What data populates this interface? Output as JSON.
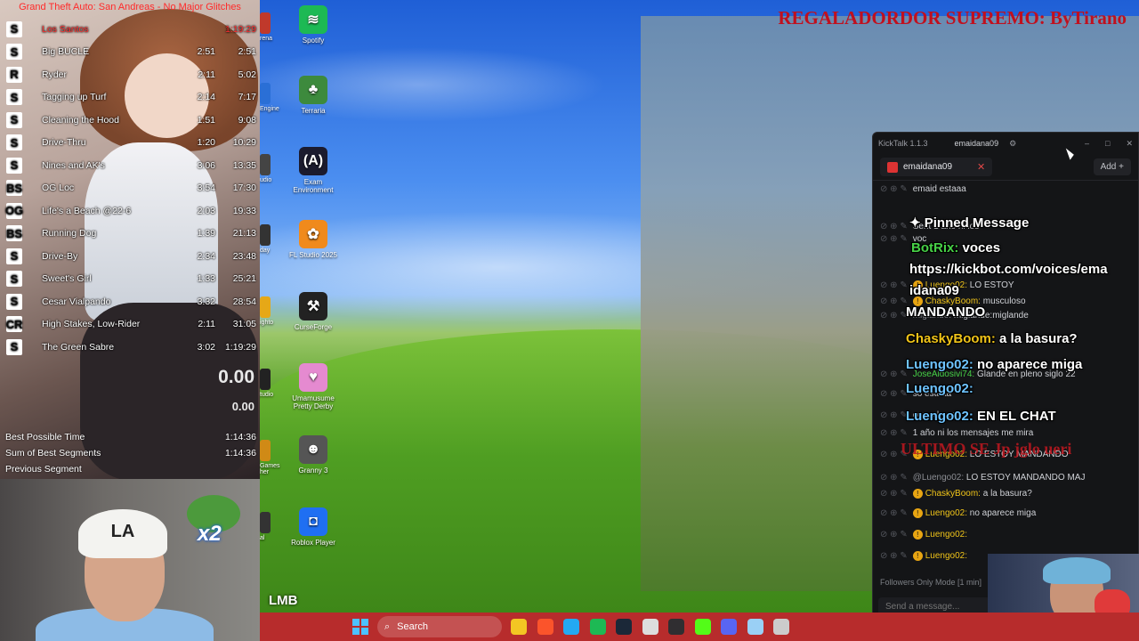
{
  "livesplit": {
    "title": "Grand Theft Auto: San Andreas - No Major Glitches",
    "splits": [
      {
        "icon": "S",
        "name": "Los Santos",
        "segment": "",
        "total": "1:19:29",
        "red": true
      },
      {
        "icon": "S",
        "name": "Big BUCLE",
        "segment": "2:51",
        "total": "2:51"
      },
      {
        "icon": "R",
        "name": "Ryder",
        "segment": "2:11",
        "total": "5:02"
      },
      {
        "icon": "S",
        "name": "Tagging up Turf",
        "segment": "2:14",
        "total": "7:17"
      },
      {
        "icon": "S",
        "name": "Cleaning the Hood",
        "segment": "1:51",
        "total": "9:08"
      },
      {
        "icon": "S",
        "name": "Drive-Thru",
        "segment": "1:20",
        "total": "10:29"
      },
      {
        "icon": "S",
        "name": "Nines and AK's",
        "segment": "3:06",
        "total": "13:35"
      },
      {
        "icon": "BS",
        "name": "OG Loc",
        "segment": "3:54",
        "total": "17:30"
      },
      {
        "icon": "OG",
        "name": "Life's a Beach @22-6",
        "segment": "2:03",
        "total": "19:33"
      },
      {
        "icon": "BS",
        "name": "Running Dog",
        "segment": "1:39",
        "total": "21:13"
      },
      {
        "icon": "S",
        "name": "Drive-By",
        "segment": "2:34",
        "total": "23:48"
      },
      {
        "icon": "S",
        "name": "Sweet's Girl",
        "segment": "1:33",
        "total": "25:21"
      },
      {
        "icon": "S",
        "name": "Cesar Vialpando",
        "segment": "3:32",
        "total": "28:54"
      },
      {
        "icon": "CR",
        "name": "High Stakes, Low-Rider",
        "segment": "2:11",
        "total": "31:05"
      },
      {
        "icon": "S",
        "name": "The Green Sabre",
        "segment": "3:02",
        "total": "1:19:29"
      }
    ],
    "timer_main": "0.00",
    "timer_segment": "0.00",
    "stats": [
      {
        "label": "Best Possible Time",
        "value": "1:14:36"
      },
      {
        "label": "Sum of Best Segments",
        "value": "1:14:36"
      },
      {
        "label": "Previous Segment",
        "value": ""
      }
    ]
  },
  "webcam": {
    "cap_logo": "LA",
    "emote_text": "x2"
  },
  "desktop_icons": [
    {
      "label": "Spotify",
      "icon": "spotify-icon",
      "color": "#1db954",
      "glyph": "≋"
    },
    {
      "label": "Terraria",
      "icon": "terraria-icon",
      "color": "#3d8a3d",
      "glyph": "♣"
    },
    {
      "label": "Exam Environment",
      "icon": "exam-environment-icon",
      "color": "#1b1b2e",
      "glyph": "(A)"
    },
    {
      "label": "FL Studio 2025",
      "icon": "fl-studio-icon",
      "color": "#f08a1c",
      "glyph": "✿"
    },
    {
      "label": "CurseForge",
      "icon": "curseforge-icon",
      "color": "#222",
      "glyph": "⚒"
    },
    {
      "label": "Umamusume Pretty Derby",
      "icon": "umamusume-icon",
      "color": "#e58ad0",
      "glyph": "♥"
    },
    {
      "label": "Granny 3",
      "icon": "granny-icon",
      "color": "#555",
      "glyph": "☻"
    },
    {
      "label": "Roblox Player",
      "icon": "roblox-icon",
      "color": "#1f6ff2",
      "glyph": "◘"
    }
  ],
  "edge_icons": [
    {
      "label": "rena",
      "color": "#c0392b"
    },
    {
      "label": "Engine",
      "color": "#2a6fd6"
    },
    {
      "label": "udio",
      "color": "#444"
    },
    {
      "label": "day",
      "color": "#333"
    },
    {
      "label": "ighto",
      "color": "#e6a817"
    },
    {
      "label": "tudio",
      "color": "#222"
    },
    {
      "label": "Games her",
      "color": "#d08a16"
    },
    {
      "label": "al",
      "color": "#333"
    }
  ],
  "stream_overlay": {
    "title": "REGALADORDOR SUPREMO: ByTirano",
    "lmb": "LMB"
  },
  "kicktalk": {
    "app_name": "KickTalk 1.1.3",
    "username": "emaidana09",
    "tab_label": "emaidana09",
    "add_label": "Add",
    "followers_mode": "Followers Only Mode [1 min]",
    "input_placeholder": "Send a message..."
  },
  "chat_lines": [
    {
      "prefix": "emaid",
      "user": "",
      "text": "estaaa",
      "color": "grey"
    },
    {
      "prefix": "Sent",
      "user": "",
      "text": "1 año ni los",
      "color": "grey"
    },
    {
      "prefix": "voc",
      "user": "",
      "text": "",
      "color": "grey"
    },
    {
      "prefix": "",
      "user": "Luengo02:",
      "text": "LO ESTOY",
      "color": "yellow"
    },
    {
      "prefix": "",
      "user": "ChaskyBoom:",
      "text": "musculoso",
      "color": "yellow"
    },
    {
      "prefix": "",
      "user": "miglande:",
      "text": "miglande:miglande",
      "color": "grey"
    },
    {
      "prefix": "",
      "user": "JoseAldosivi74:",
      "text": "Glande en pleno siglo 22",
      "color": "green"
    },
    {
      "prefix": "",
      "user": "",
      "text": "so estaaa",
      "color": "grey"
    },
    {
      "prefix": "",
      "user": "",
      "text": "como hace",
      "color": "grey"
    },
    {
      "prefix": "",
      "user": "",
      "text": "1 año ni los mensajes me mira",
      "color": "grey"
    },
    {
      "prefix": "",
      "user": "Luengo02:",
      "text": "LO ESTOY MANDANDO",
      "color": "yellow"
    },
    {
      "prefix": "",
      "user": "@Luengo02:",
      "text": "LO ESTOY MANDANDO MAJ",
      "color": "grey"
    },
    {
      "prefix": "",
      "user": "ChaskyBoom:",
      "text": "a la basura?",
      "color": "yellow"
    },
    {
      "prefix": "",
      "user": "Luengo02:",
      "text": "no aparece miga",
      "color": "yellow"
    },
    {
      "prefix": "",
      "user": "Luengo02:",
      "text": "",
      "color": "yellow"
    },
    {
      "prefix": "",
      "user": "Luengo02:",
      "text": "",
      "color": "yellow"
    }
  ],
  "pinned_overlay": {
    "header": "Pinned Message",
    "lines": [
      {
        "user": "BotRix:",
        "text": "voces",
        "color": "green"
      },
      {
        "user": "",
        "text": "https://kickbot.com/voices/ema",
        "color": "white"
      },
      {
        "user": "",
        "text": "idana09",
        "color": "white"
      },
      {
        "user": "",
        "text": "MANDANDO",
        "color": "white"
      },
      {
        "user": "ChaskyBoom:",
        "text": "a la basura?",
        "color": "yellow"
      },
      {
        "user": "Luengo02:",
        "text": "no aparece miga",
        "color": "blue"
      },
      {
        "user": "Luengo02:",
        "text": "",
        "color": "blue"
      },
      {
        "user": "Luengo02:",
        "text": "EN EL CHAT",
        "color": "blue"
      }
    ],
    "red_text": "ULTIMO SE Jp jglo ueri"
  },
  "taskbar": {
    "search_label": "Search",
    "apps": [
      {
        "icon": "file-explorer-icon",
        "color": "#f3c623"
      },
      {
        "icon": "brave-icon",
        "color": "#fb542b"
      },
      {
        "icon": "vscode-icon",
        "color": "#23a9f2"
      },
      {
        "icon": "spotify-icon",
        "color": "#1db954"
      },
      {
        "icon": "steam-icon",
        "color": "#1b2838"
      },
      {
        "icon": "app-icon",
        "color": "#ddd"
      },
      {
        "icon": "obs-icon",
        "color": "#302e31"
      },
      {
        "icon": "kick-icon",
        "color": "#53fc18"
      },
      {
        "icon": "discord-icon",
        "color": "#5865f2"
      },
      {
        "icon": "app2-icon",
        "color": "#9ad0f5"
      },
      {
        "icon": "app3-icon",
        "color": "#ccc"
      }
    ]
  }
}
